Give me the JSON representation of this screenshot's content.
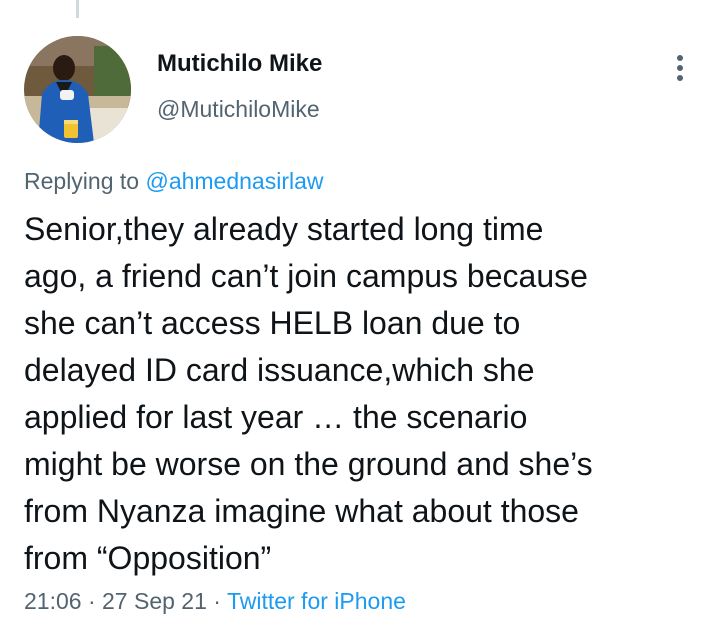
{
  "tweet": {
    "author": {
      "display_name": "Mutichilo Mike",
      "handle": "@MutichiloMike"
    },
    "reply": {
      "prefix": "Replying to",
      "mention": "@ahmednasirlaw"
    },
    "text": "Senior,they already started long time\nago, a friend can’t join campus because\nshe can’t access HELB loan due to\ndelayed ID card issuance,which she\napplied for last year … the scenario\nmight be worse on the ground and she’s\nfrom Nyanza imagine what about those\nfrom “Opposition”",
    "meta": {
      "time": "21:06",
      "separator": "·",
      "date": "27 Sep 21",
      "source": "Twitter for iPhone"
    }
  },
  "colors": {
    "text_primary": "#0f1419",
    "text_secondary": "#536471",
    "link": "#1d9bf0",
    "thread_line": "#cfd9de"
  },
  "icons": {
    "more_menu": "vertical-ellipsis-icon"
  }
}
